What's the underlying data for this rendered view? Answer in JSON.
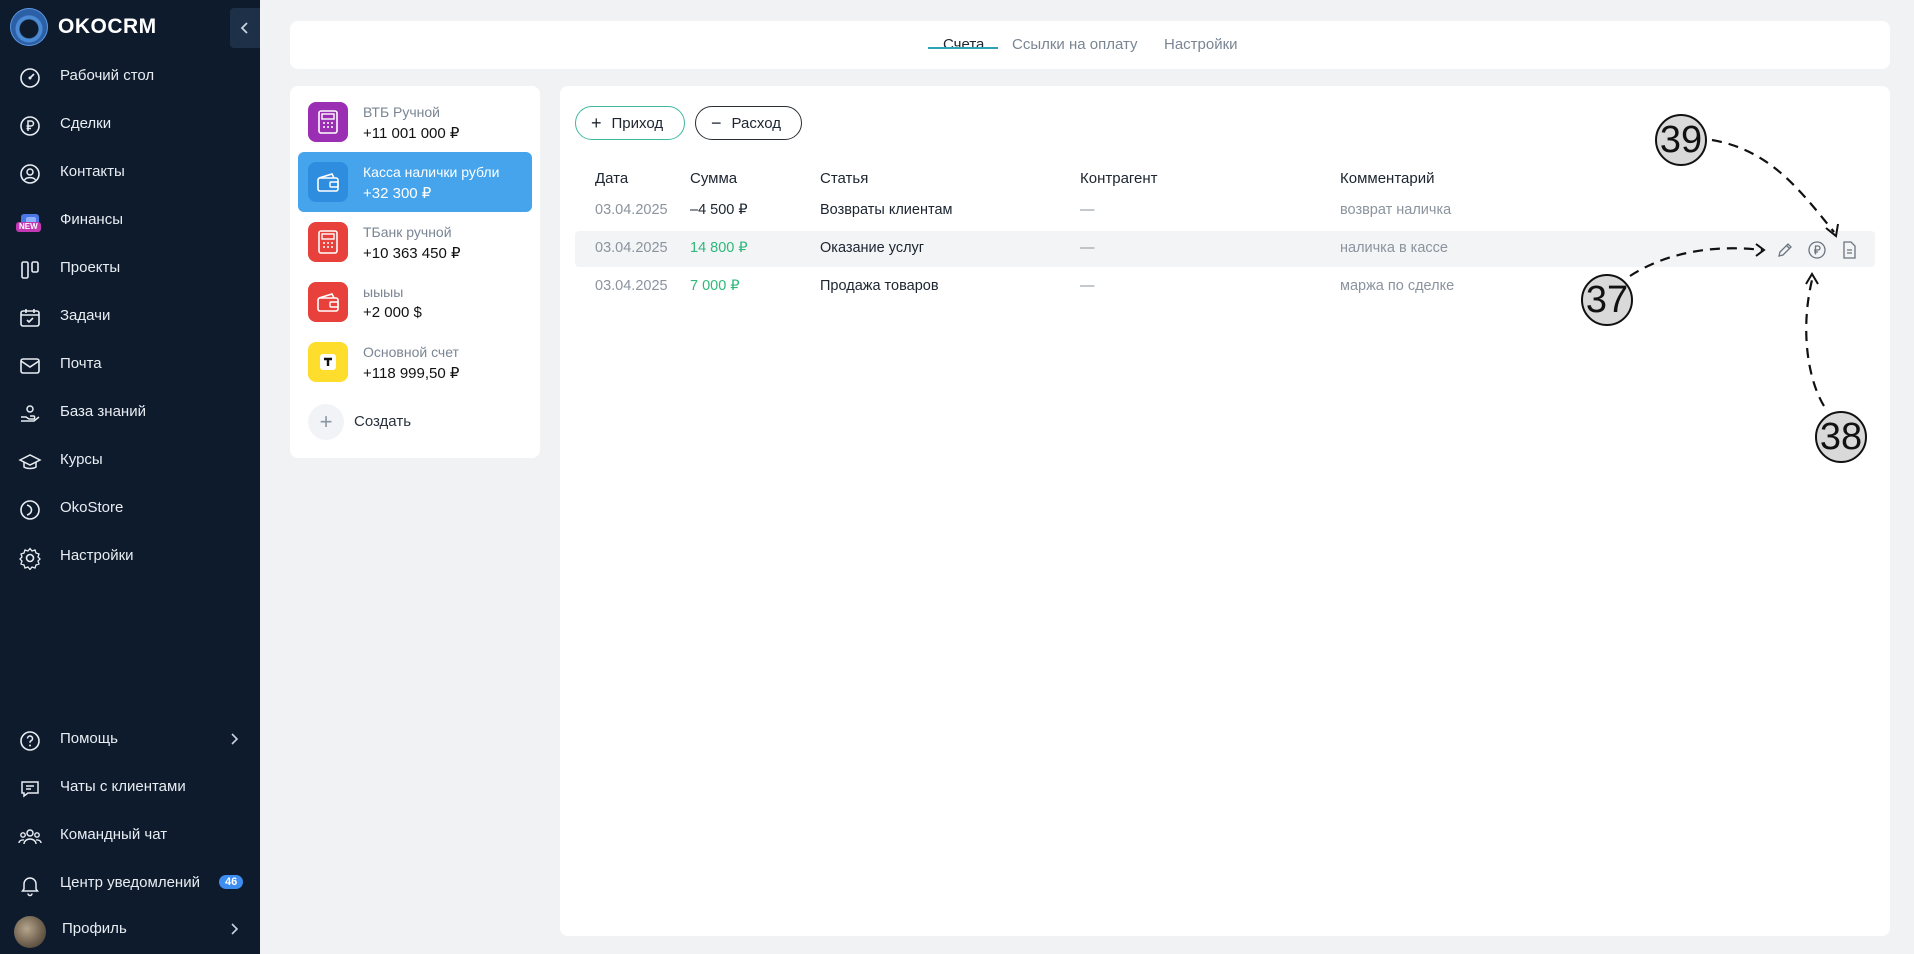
{
  "app": {
    "name": "OKOCRM"
  },
  "sidebar": {
    "items": [
      {
        "label": "Рабочий стол"
      },
      {
        "label": "Сделки"
      },
      {
        "label": "Контакты"
      },
      {
        "label": "Финансы",
        "badge": "NEW"
      },
      {
        "label": "Проекты"
      },
      {
        "label": "Задачи"
      },
      {
        "label": "Почта"
      },
      {
        "label": "База знаний"
      },
      {
        "label": "Курсы"
      },
      {
        "label": "OkoStore"
      },
      {
        "label": "Настройки"
      }
    ],
    "bottom": [
      {
        "label": "Помощь"
      },
      {
        "label": "Чаты с клиентами"
      },
      {
        "label": "Командный чат"
      },
      {
        "label": "Центр уведомлений",
        "count": "46"
      },
      {
        "label": "Профиль"
      }
    ]
  },
  "tabs": [
    {
      "label": "Счета",
      "active": true
    },
    {
      "label": "Ссылки на оплату"
    },
    {
      "label": "Настройки"
    }
  ],
  "accounts": {
    "items": [
      {
        "name": "ВТБ Ручной",
        "balance": "+11 001 000 ₽",
        "icon": "calculator-icon",
        "color": "#9b2fb4"
      },
      {
        "name": "Касса налички рубли",
        "balance": "+32 300 ₽",
        "icon": "wallet-icon",
        "color": "#2f8de0",
        "selected": true
      },
      {
        "name": "ТБанк ручной",
        "balance": "+10 363 450 ₽",
        "icon": "calculator-icon",
        "color": "#e8413b"
      },
      {
        "name": "ыыыы",
        "balance": "+2 000 $",
        "icon": "wallet-icon",
        "color": "#e8413b"
      },
      {
        "name": "Основной счет",
        "balance": "+118 999,50 ₽",
        "icon": "tbank-icon",
        "color": "#ffdd2d"
      }
    ],
    "create_label": "Создать"
  },
  "toolbar": {
    "income_label": "Приход",
    "expense_label": "Расход"
  },
  "table": {
    "headers": [
      "Дата",
      "Сумма",
      "Статья",
      "Контрагент",
      "Комментарий"
    ],
    "rows": [
      {
        "date": "03.04.2025",
        "amount": "–4 500 ₽",
        "type": "negative",
        "article": "Возвраты клиентам",
        "counterparty": "—",
        "comment": "возврат наличка"
      },
      {
        "date": "03.04.2025",
        "amount": "14 800 ₽",
        "type": "positive",
        "article": "Оказание услуг",
        "counterparty": "—",
        "comment": "наличка в кассе"
      },
      {
        "date": "03.04.2025",
        "amount": "7 000 ₽",
        "type": "positive",
        "article": "Продажа товаров",
        "counterparty": "—",
        "comment": "маржа по сделке"
      }
    ]
  },
  "annotations": [
    "37",
    "38",
    "39"
  ],
  "colors": {
    "sidebar_bg": "#0e1b2c",
    "accent": "#45a4ec",
    "positive": "#2fb87a",
    "income_border": "#3fb8a0"
  }
}
